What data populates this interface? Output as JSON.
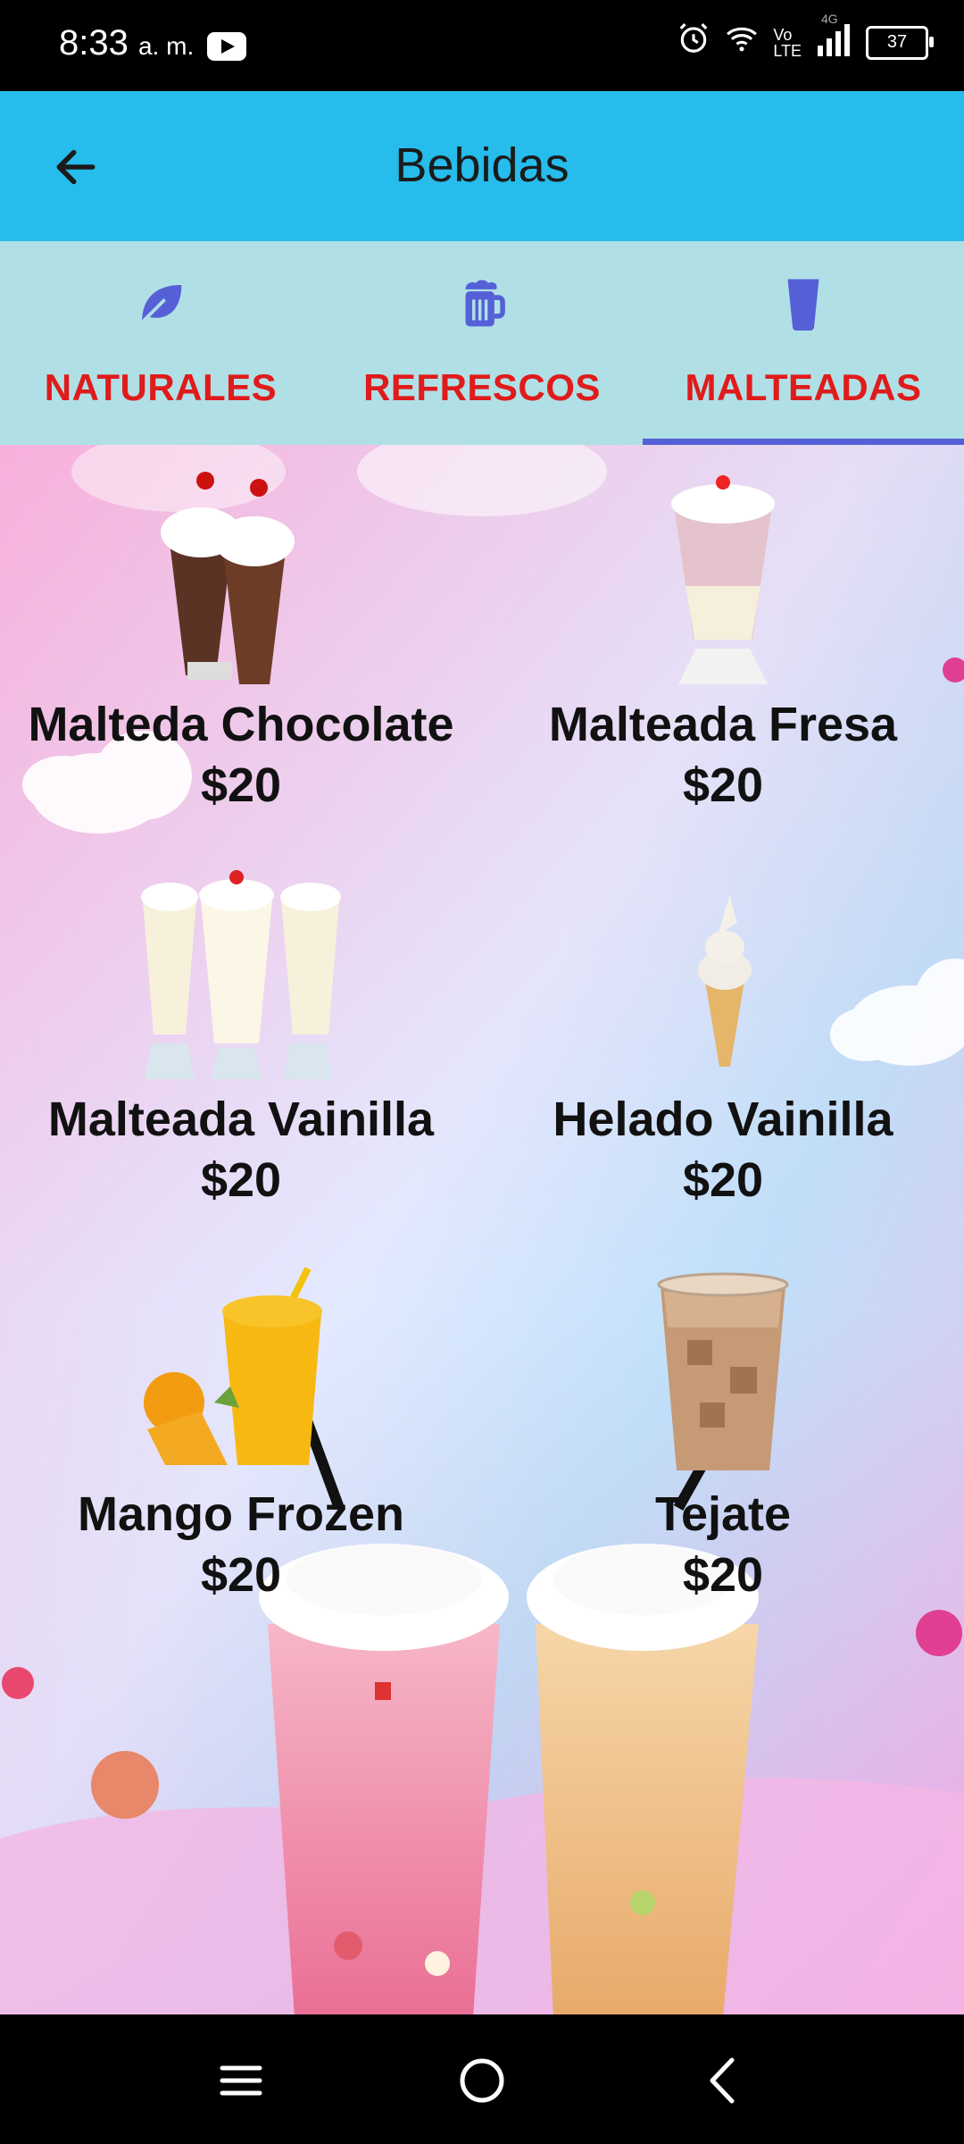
{
  "status_bar": {
    "time": "8:33",
    "ampm": "a. m.",
    "network": "4G",
    "volte": "Vo\nLTE",
    "battery": "37"
  },
  "app_bar": {
    "title": "Bebidas"
  },
  "tabs": [
    {
      "label": "NATURALES",
      "icon": "leaf-icon",
      "selected": false
    },
    {
      "label": "REFRESCOS",
      "icon": "beer-mug-icon",
      "selected": false
    },
    {
      "label": "MALTEADAS",
      "icon": "glass-icon",
      "selected": true
    }
  ],
  "products": [
    {
      "name": "Malteda Chocolate",
      "price": "$20",
      "image": "chocolate-shake"
    },
    {
      "name": "Malteada Fresa",
      "price": "$20",
      "image": "strawberry-shake"
    },
    {
      "name": "Malteada Vainilla",
      "price": "$20",
      "image": "vanilla-shakes"
    },
    {
      "name": "Helado Vainilla",
      "price": "$20",
      "image": "vanilla-cone"
    },
    {
      "name": "Mango Frozen",
      "price": "$20",
      "image": "mango-frozen"
    },
    {
      "name": "Tejate",
      "price": "$20",
      "image": "iced-coffee"
    }
  ],
  "colors": {
    "app_bar": "#26BCEB",
    "tab_bar": "#B0E0E6",
    "tab_label": "#E01B1B",
    "tab_icon": "#5560D6",
    "indicator": "#5560D6"
  }
}
